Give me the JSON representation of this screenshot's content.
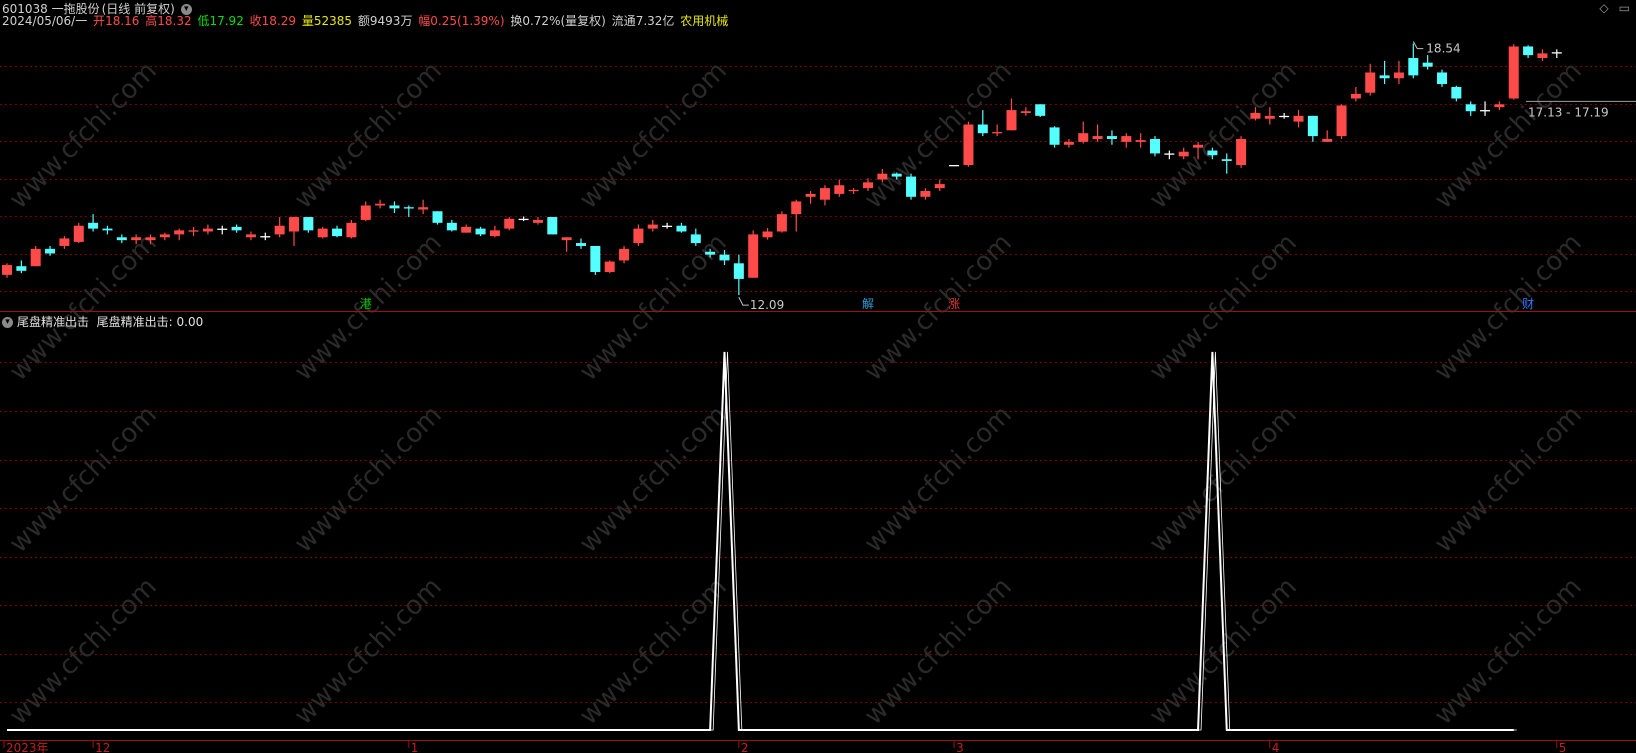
{
  "header": {
    "code_name": "601038 一拖股份",
    "period": "(日线 前复权)",
    "date": "2024/05/06/一",
    "open_label": "开",
    "open": "18.16",
    "high_label": "高",
    "high": "18.32",
    "low_label": "低",
    "low": "17.92",
    "close_label": "收",
    "close": "18.29",
    "vol_label": "量",
    "vol": "52385",
    "amount_label": "额",
    "amount": "9493万",
    "change_label": "幅",
    "change": "0.25(1.39%)",
    "turnover_label": "换",
    "turnover": "0.72%(量复权)",
    "float_label": "流通",
    "float": "7.32亿",
    "sector": "农用机械"
  },
  "indicator": {
    "name": "尾盘精准出击",
    "value_label": "尾盘精准出击:",
    "value": "0.00",
    "values": [
      0,
      0,
      0,
      0,
      0,
      0,
      0,
      0,
      0,
      0,
      0,
      0,
      0,
      0,
      0,
      0,
      0,
      0,
      0,
      0,
      0,
      0,
      0,
      0,
      0,
      0,
      0,
      0,
      0,
      0,
      0,
      0,
      0,
      0,
      0,
      0,
      0,
      0,
      0,
      0,
      0,
      0,
      0,
      0,
      0,
      0,
      0,
      0,
      0,
      0,
      1,
      0,
      0,
      0,
      0,
      0,
      0,
      0,
      0,
      0,
      0,
      0,
      0,
      0,
      0,
      0,
      0,
      0,
      0,
      0,
      0,
      0,
      0,
      0,
      0,
      0,
      0,
      0,
      0,
      0,
      0,
      0,
      0,
      0,
      1,
      0,
      0,
      0,
      0,
      0,
      0,
      0,
      0,
      0,
      0,
      0,
      0,
      0,
      0,
      0,
      0,
      0,
      0,
      0,
      0,
      0
    ],
    "ylim": [
      0,
      1.05
    ]
  },
  "corner_icons": [
    "diamond-icon",
    "expand-icon"
  ],
  "watermark": "www.cfchi.com",
  "colors": {
    "up": "#ff4a4a",
    "down": "#54ffff",
    "doji": "#ffffff",
    "grid": "#7a0000",
    "indicator_line": "#ffffff",
    "bg": "#000000"
  },
  "chart_data": {
    "type": "candlestick",
    "title": "601038 一拖股份 (日线 前复权)",
    "ohlc_order": [
      "open",
      "high",
      "low",
      "close"
    ],
    "candles": [
      [
        12.55,
        12.75,
        12.5,
        12.72
      ],
      [
        12.7,
        12.8,
        12.58,
        12.62
      ],
      [
        12.7,
        13.05,
        12.7,
        13.0
      ],
      [
        13.0,
        13.05,
        12.88,
        12.92
      ],
      [
        13.05,
        13.22,
        13.0,
        13.18
      ],
      [
        13.12,
        13.45,
        13.1,
        13.4
      ],
      [
        13.45,
        13.6,
        13.3,
        13.35
      ],
      [
        13.35,
        13.4,
        13.25,
        13.32
      ],
      [
        13.2,
        13.25,
        13.1,
        13.15
      ],
      [
        13.15,
        13.25,
        13.08,
        13.2
      ],
      [
        13.15,
        13.25,
        13.08,
        13.2
      ],
      [
        13.2,
        13.28,
        13.15,
        13.25
      ],
      [
        13.25,
        13.35,
        13.15,
        13.32
      ],
      [
        13.3,
        13.38,
        13.22,
        13.32
      ],
      [
        13.3,
        13.42,
        13.25,
        13.35
      ],
      [
        13.35,
        13.4,
        13.25,
        13.35
      ],
      [
        13.38,
        13.42,
        13.28,
        13.32
      ],
      [
        13.2,
        13.3,
        13.15,
        13.25
      ],
      [
        13.22,
        13.28,
        13.15,
        13.22
      ],
      [
        13.25,
        13.55,
        13.2,
        13.4
      ],
      [
        13.3,
        13.55,
        13.05,
        13.55
      ],
      [
        13.55,
        13.55,
        13.28,
        13.32
      ],
      [
        13.2,
        13.38,
        13.18,
        13.35
      ],
      [
        13.35,
        13.4,
        13.2,
        13.22
      ],
      [
        13.2,
        13.5,
        13.18,
        13.45
      ],
      [
        13.5,
        13.82,
        13.48,
        13.75
      ],
      [
        13.75,
        13.85,
        13.7,
        13.78
      ],
      [
        13.75,
        13.82,
        13.62,
        13.7
      ],
      [
        13.72,
        13.75,
        13.55,
        13.7
      ],
      [
        13.68,
        13.85,
        13.6,
        13.72
      ],
      [
        13.65,
        13.65,
        13.42,
        13.45
      ],
      [
        13.45,
        13.5,
        13.3,
        13.32
      ],
      [
        13.28,
        13.42,
        13.28,
        13.38
      ],
      [
        13.35,
        13.38,
        13.22,
        13.25
      ],
      [
        13.22,
        13.4,
        13.2,
        13.32
      ],
      [
        13.35,
        13.55,
        13.32,
        13.52
      ],
      [
        13.52,
        13.56,
        13.48,
        13.52
      ],
      [
        13.45,
        13.55,
        13.42,
        13.5
      ],
      [
        13.55,
        13.55,
        13.25,
        13.25
      ],
      [
        13.15,
        13.2,
        12.95,
        13.2
      ],
      [
        13.1,
        13.18,
        13.0,
        13.05
      ],
      [
        13.05,
        13.05,
        12.55,
        12.6
      ],
      [
        12.6,
        12.8,
        12.58,
        12.78
      ],
      [
        12.8,
        13.05,
        12.75,
        13.0
      ],
      [
        13.1,
        13.42,
        13.05,
        13.35
      ],
      [
        13.35,
        13.5,
        13.3,
        13.42
      ],
      [
        13.4,
        13.45,
        13.35,
        13.4
      ],
      [
        13.4,
        13.45,
        13.28,
        13.3
      ],
      [
        13.25,
        13.35,
        13.05,
        13.1
      ],
      [
        12.95,
        13.0,
        12.85,
        12.9
      ],
      [
        12.9,
        12.98,
        12.72,
        12.8
      ],
      [
        12.75,
        12.9,
        12.2,
        12.48
      ],
      [
        12.5,
        13.32,
        12.5,
        13.25
      ],
      [
        13.2,
        13.36,
        13.16,
        13.3
      ],
      [
        13.3,
        13.65,
        13.28,
        13.6
      ],
      [
        13.6,
        13.85,
        13.3,
        13.82
      ],
      [
        13.9,
        14.0,
        13.78,
        13.95
      ],
      [
        13.85,
        14.1,
        13.75,
        14.05
      ],
      [
        13.95,
        14.2,
        13.9,
        14.1
      ],
      [
        14.0,
        14.05,
        13.95,
        14.02
      ],
      [
        14.05,
        14.22,
        14.0,
        14.15
      ],
      [
        14.2,
        14.38,
        14.15,
        14.3
      ],
      [
        14.3,
        14.32,
        14.2,
        14.25
      ],
      [
        14.25,
        14.3,
        13.85,
        13.9
      ],
      [
        13.9,
        14.05,
        13.85,
        14.0
      ],
      [
        14.05,
        14.2,
        14.0,
        14.12
      ],
      [
        14.45,
        14.45,
        14.45,
        14.45
      ],
      [
        14.45,
        15.2,
        14.42,
        15.15
      ],
      [
        15.15,
        15.4,
        14.95,
        15.0
      ],
      [
        15.0,
        15.15,
        14.95,
        15.02
      ],
      [
        15.05,
        15.6,
        15.05,
        15.4
      ],
      [
        15.35,
        15.45,
        15.3,
        15.38
      ],
      [
        15.5,
        15.5,
        15.28,
        15.3
      ],
      [
        15.1,
        15.12,
        14.75,
        14.8
      ],
      [
        14.8,
        14.9,
        14.75,
        14.85
      ],
      [
        14.85,
        15.2,
        14.82,
        15.0
      ],
      [
        14.9,
        15.15,
        14.85,
        14.95
      ],
      [
        14.95,
        15.05,
        14.8,
        14.9
      ],
      [
        14.85,
        15.0,
        14.75,
        14.95
      ],
      [
        14.85,
        15.0,
        14.75,
        14.88
      ],
      [
        14.9,
        14.95,
        14.6,
        14.65
      ],
      [
        14.65,
        14.7,
        14.55,
        14.65
      ],
      [
        14.6,
        14.75,
        14.55,
        14.68
      ],
      [
        14.75,
        14.85,
        14.55,
        14.8
      ],
      [
        14.7,
        14.75,
        14.55,
        14.62
      ],
      [
        14.55,
        14.65,
        14.3,
        14.52
      ],
      [
        14.45,
        14.95,
        14.4,
        14.9
      ],
      [
        15.25,
        15.45,
        15.22,
        15.35
      ],
      [
        15.25,
        15.45,
        15.15,
        15.3
      ],
      [
        15.3,
        15.35,
        15.25,
        15.3
      ],
      [
        15.2,
        15.4,
        15.1,
        15.3
      ],
      [
        15.3,
        15.3,
        14.85,
        14.95
      ],
      [
        14.85,
        15.05,
        14.85,
        14.9
      ],
      [
        14.95,
        15.5,
        14.9,
        15.48
      ],
      [
        15.6,
        15.8,
        15.55,
        15.68
      ],
      [
        15.7,
        16.2,
        15.65,
        16.05
      ],
      [
        16.0,
        16.25,
        15.85,
        15.95
      ],
      [
        15.95,
        16.25,
        15.85,
        16.05
      ],
      [
        16.3,
        16.55,
        15.95,
        16.0
      ],
      [
        16.22,
        16.35,
        16.1,
        16.15
      ],
      [
        16.05,
        16.1,
        15.8,
        15.85
      ],
      [
        15.8,
        15.82,
        15.55,
        15.6
      ],
      [
        15.5,
        15.55,
        15.3,
        15.38
      ],
      [
        15.4,
        15.55,
        15.3,
        15.4
      ],
      [
        15.45,
        15.55,
        15.4,
        15.5
      ],
      [
        15.6,
        16.54,
        15.58,
        16.5
      ],
      [
        16.5,
        16.52,
        16.3,
        16.35
      ],
      [
        16.3,
        16.45,
        16.25,
        16.38
      ],
      [
        16.4,
        16.45,
        16.3,
        16.4
      ]
    ],
    "annotations": [
      {
        "text": "12.09",
        "type": "low_marker"
      },
      {
        "text": "18.54",
        "type": "high_marker"
      },
      {
        "text": "17.13 - 17.19",
        "type": "price_range"
      }
    ],
    "event_markers": [
      {
        "text": "港",
        "color": "#00c000",
        "index": 25
      },
      {
        "text": "解",
        "color": "#2aa0d8",
        "index": 60
      },
      {
        "text": "涨",
        "color": "#e03030",
        "index": 66
      },
      {
        "text": "财",
        "color": "#3a78ff",
        "index": 106
      }
    ],
    "x_ticks": [
      {
        "label": "2023年",
        "index": 0
      },
      {
        "label": "12",
        "index": 6
      },
      {
        "label": "1",
        "index": 28
      },
      {
        "label": "2",
        "index": 51
      },
      {
        "label": "3",
        "index": 66
      },
      {
        "label": "4",
        "index": 88
      },
      {
        "label": "5",
        "index": 108
      }
    ],
    "ylim": [
      12.15,
      16.75
    ]
  }
}
